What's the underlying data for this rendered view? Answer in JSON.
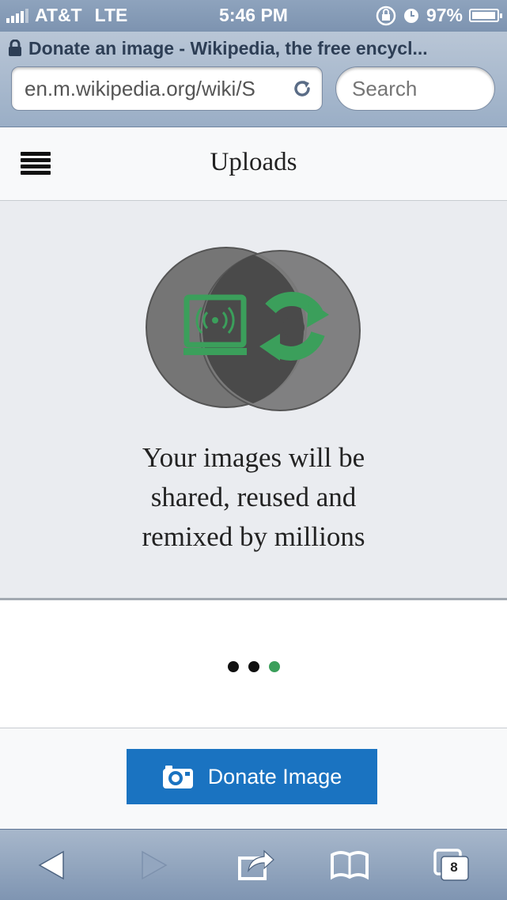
{
  "status_bar": {
    "carrier": "AT&T",
    "network": "LTE",
    "time": "5:46 PM",
    "battery": "97%",
    "icons": [
      "signal-icon",
      "orientation-lock-icon",
      "alarm-icon",
      "battery-icon"
    ]
  },
  "browser": {
    "page_title": "Donate an image - Wikipedia, the free encycl...",
    "url": "en.m.wikipedia.org/wiki/S",
    "search_placeholder": "Search",
    "tab_count": "8"
  },
  "header": {
    "title": "Uploads",
    "menu_icon": "hamburger-menu-icon"
  },
  "carousel": {
    "slide_text_lines": [
      "Your images will be",
      "shared, reused and",
      "remixed by millions"
    ],
    "pages": 3,
    "active_page": 3,
    "accent_color": "#3b9f5b"
  },
  "action": {
    "donate_label": "Donate Image",
    "button_color": "#1a73c1"
  },
  "toolbar": {
    "items": [
      "back-icon",
      "forward-icon",
      "share-icon",
      "bookmarks-icon",
      "tabs-icon"
    ]
  }
}
